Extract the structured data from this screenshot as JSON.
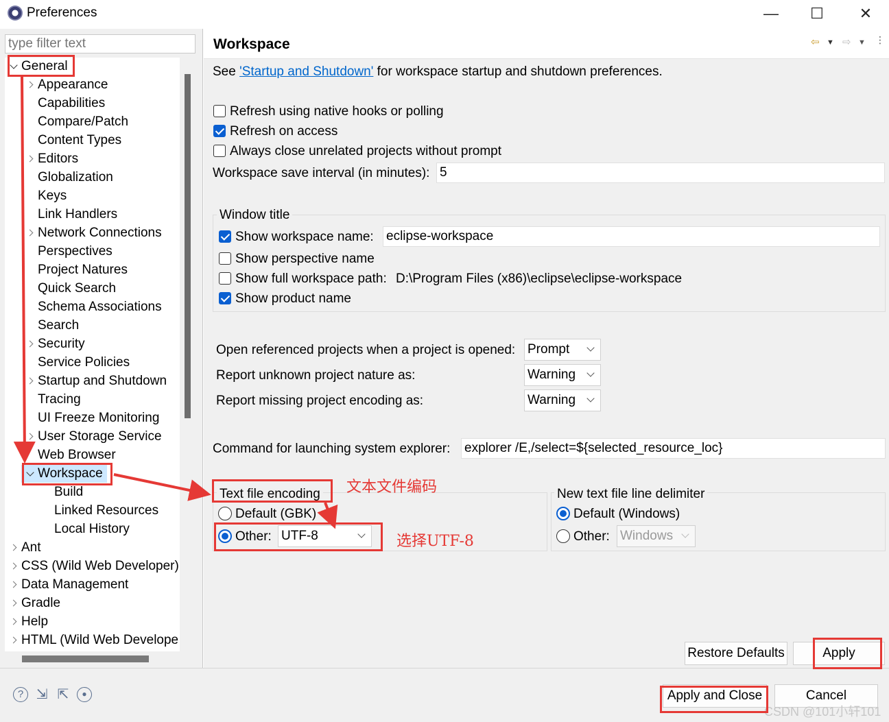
{
  "window": {
    "title": "Preferences",
    "controls": [
      "—",
      "☐",
      "✕"
    ]
  },
  "filter": {
    "placeholder": "type filter text"
  },
  "tree": {
    "general": "General",
    "general_children": [
      {
        "label": "Appearance",
        "expandable": true
      },
      {
        "label": "Capabilities",
        "expandable": false
      },
      {
        "label": "Compare/Patch",
        "expandable": false
      },
      {
        "label": "Content Types",
        "expandable": false
      },
      {
        "label": "Editors",
        "expandable": true
      },
      {
        "label": "Globalization",
        "expandable": false
      },
      {
        "label": "Keys",
        "expandable": false
      },
      {
        "label": "Link Handlers",
        "expandable": false
      },
      {
        "label": "Network Connections",
        "expandable": true
      },
      {
        "label": "Perspectives",
        "expandable": false
      },
      {
        "label": "Project Natures",
        "expandable": false
      },
      {
        "label": "Quick Search",
        "expandable": false
      },
      {
        "label": "Schema Associations",
        "expandable": false
      },
      {
        "label": "Search",
        "expandable": false
      },
      {
        "label": "Security",
        "expandable": true
      },
      {
        "label": "Service Policies",
        "expandable": false
      },
      {
        "label": "Startup and Shutdown",
        "expandable": true
      },
      {
        "label": "Tracing",
        "expandable": false
      },
      {
        "label": "UI Freeze Monitoring",
        "expandable": false
      },
      {
        "label": "User Storage Service",
        "expandable": true
      },
      {
        "label": "Web Browser",
        "expandable": false
      }
    ],
    "workspace": "Workspace",
    "workspace_children": [
      "Build",
      "Linked Resources",
      "Local History"
    ],
    "top_level": [
      "Ant",
      "CSS (Wild Web Developer)",
      "Data Management",
      "Gradle",
      "Help",
      "HTML (Wild Web Develope"
    ]
  },
  "page": {
    "title": "Workspace",
    "see_prefix": "See ",
    "see_link": "'Startup and Shutdown'",
    "see_suffix": " for workspace startup and shutdown preferences.",
    "refresh_native": "Refresh using native hooks or polling",
    "refresh_native_checked": false,
    "refresh_access": "Refresh on access",
    "refresh_access_checked": true,
    "always_close": "Always close unrelated projects without prompt",
    "always_close_checked": false,
    "save_interval_label": "Workspace save interval (in minutes):",
    "save_interval_value": "5",
    "window_title": {
      "heading": "Window title",
      "show_ws_name": "Show workspace name:",
      "show_ws_name_checked": true,
      "ws_name_value": "eclipse-workspace",
      "show_perspective": "Show perspective name",
      "show_perspective_checked": false,
      "show_full_path": "Show full workspace path:",
      "show_full_path_checked": false,
      "full_path_value": "D:\\Program Files (x86)\\eclipse\\eclipse-workspace",
      "show_product": "Show product name",
      "show_product_checked": true
    },
    "open_ref_label": "Open referenced projects when a project is opened:",
    "open_ref_value": "Prompt",
    "unknown_nature_label": "Report unknown project nature as:",
    "unknown_nature_value": "Warning",
    "missing_encoding_label": "Report missing project encoding as:",
    "missing_encoding_value": "Warning",
    "explorer_label": "Command for launching system explorer:",
    "explorer_value": "explorer /E,/select=${selected_resource_loc}",
    "encoding": {
      "heading": "Text file encoding",
      "default_label": "Default (GBK)",
      "other_label": "Other:",
      "other_value": "UTF-8",
      "selected": "other"
    },
    "delimiter": {
      "heading": "New text file line delimiter",
      "default_label": "Default (Windows)",
      "other_label": "Other:",
      "other_value": "Windows",
      "selected": "default"
    },
    "restore_defaults": "Restore Defaults",
    "apply": "Apply"
  },
  "footer": {
    "apply_close": "Apply and Close",
    "cancel": "Cancel",
    "icons": [
      "help-icon",
      "import-icon",
      "export-icon",
      "record-icon"
    ]
  },
  "annotations": {
    "encoding_note": "文本文件编码",
    "utf8_note": "选择UTF-8",
    "accent": "#e53935"
  },
  "watermark": "CSDN @101小轩101"
}
